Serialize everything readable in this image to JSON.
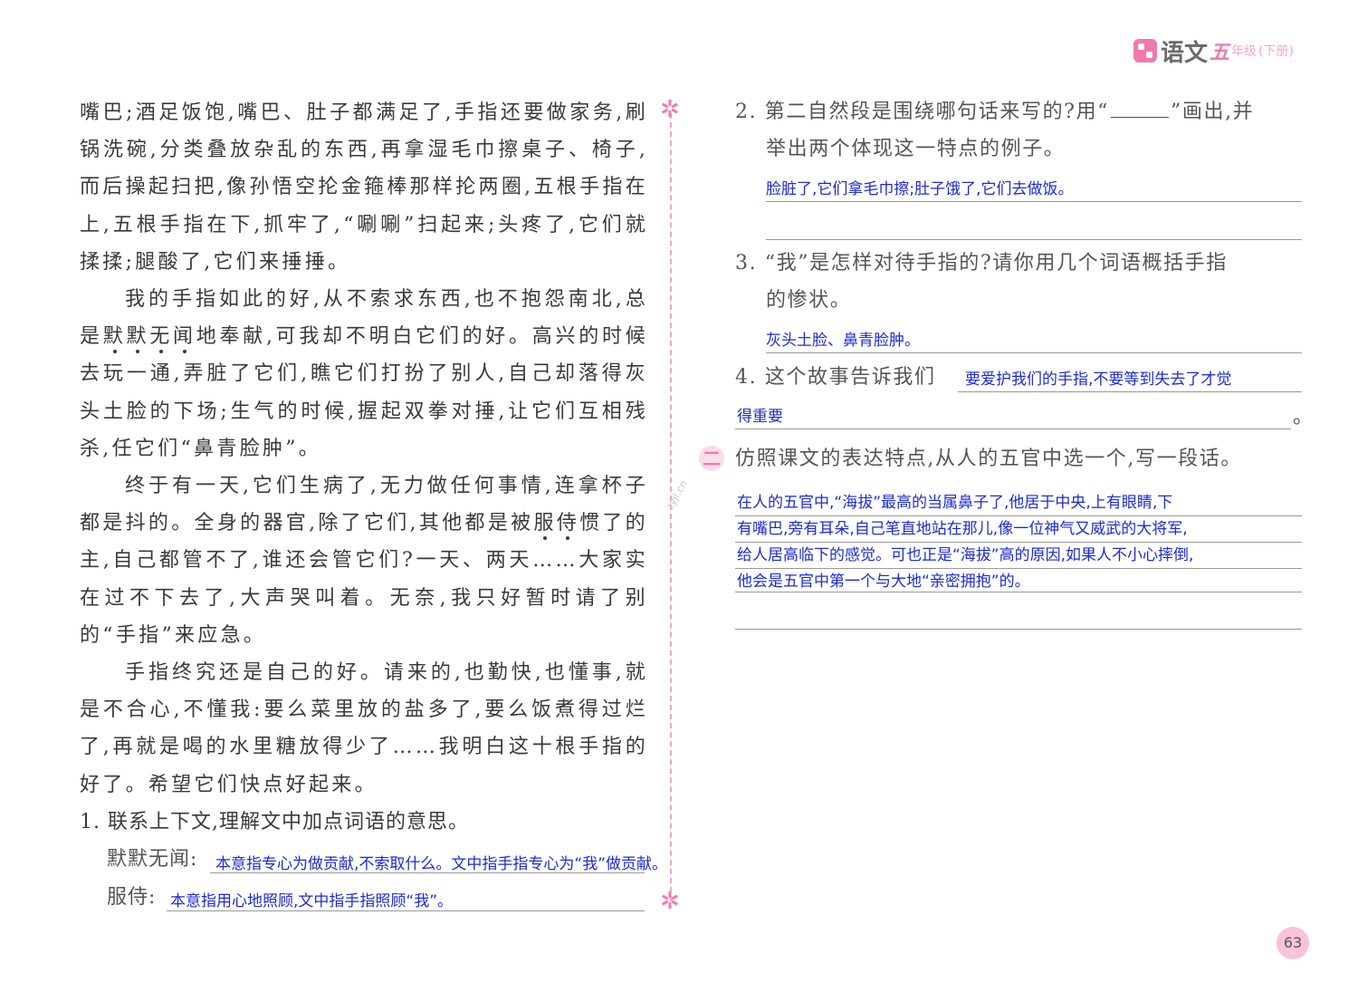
{
  "header": {
    "title": "语文",
    "grade": "五",
    "grade_suffix": "年级",
    "volume": "(下册)"
  },
  "passage": {
    "paragraphs": [
      {
        "indent": false,
        "segments": [
          {
            "t": "嘴巴;酒足饭饱,嘴巴、肚子都满足了,手指还要做家务,刷锅洗碗,分类叠放杂乱的东西,再拿湿毛巾擦桌子、椅子,而后操起扫把,像孙悟空抡金箍棒那样抡两圈,五根手指在上,五根手指在下,抓牢了,“唰唰”扫起来;头疼了,它们就揉揉;腿酸了,它们来捶捶。"
          }
        ]
      },
      {
        "indent": true,
        "segments": [
          {
            "t": "我的手指如此的好,从不索求东西,也不抱怨南北,总是"
          },
          {
            "t": "默默无闻",
            "dot": true
          },
          {
            "t": "地奉献,可我却不明白它们的好。高兴的时候去玩一通,弄脏了它们,瞧它们打扮了别人,自己却落得灰头土脸的下场;生气的时候,握起双拳对捶,让它们互相残杀,任它们“鼻青脸肿”。"
          }
        ]
      },
      {
        "indent": true,
        "segments": [
          {
            "t": "终于有一天,它们生病了,无力做任何事情,连拿杯子都是抖的。全身的器官,除了它们,其他都是被"
          },
          {
            "t": "服侍",
            "dot": true
          },
          {
            "t": "惯了的主,自己都管不了,谁还会管它们?一天、两天……大家实在过不下去了,大声哭叫着。无奈,我只好暂时请了别的“手指”来应急。"
          }
        ]
      },
      {
        "indent": true,
        "segments": [
          {
            "t": "手指终究还是自己的好。请来的,也勤快,也懂事,就是不合心,不懂我:要么菜里放的盐多了,要么饭煮得过烂了,再就是喝的水里糖放得少了……我明白这十根手指的好了。希望它们快点好起来。"
          }
        ]
      }
    ]
  },
  "questions": {
    "q1": {
      "prompt": "1. 联系上下文,理解文中加点词语的意思。",
      "items": [
        {
          "label": "默默无闻:",
          "answer": "本意指专心为做贡献,不索取什么。文中指手指专心为“我”做贡献。"
        },
        {
          "label": "服侍:",
          "answer": "本意指用心地照顾,文中指手指照顾“我”。"
        }
      ]
    },
    "q2": {
      "prompt_before": "2. 第二自然段是围绕哪句话来写的?用“",
      "prompt_after": "”画出,并",
      "prompt_line2": "举出两个体现这一特点的例子。",
      "answer": "脸脏了,它们拿毛巾擦;肚子饿了,它们去做饭。"
    },
    "q3": {
      "prompt_line1": "3. “我”是怎样对待手指的?请你用几个词语概括手指",
      "prompt_line2": "的惨状。",
      "answer": "灰头土脸、鼻青脸肿。"
    },
    "q4": {
      "prompt": "4. 这个故事告诉我们",
      "answer_line1": "要爱护我们的手指,不要等到失去了才觉",
      "answer_line2": "得重要",
      "end_mark": "。"
    }
  },
  "section2": {
    "badge": "二",
    "prompt": "仿照课文的表达特点,从人的五官中选一个,写一段话。",
    "answer_lines": [
      "在人的五官中,“海拔”最高的当属鼻子了,他居于中央,上有眼睛,下",
      "有嘴巴,旁有耳朵,自己笔直地站在那儿,像一位神气又威武的大将军,",
      "给人居高临下的感觉。可也正是“海拔”高的原因,如果人不小心摔倒,",
      "他会是五官中第一个与大地“亲密拥抱”的。"
    ]
  },
  "decor": {
    "star": "✲",
    "watermark": "zyjl.cn"
  },
  "page_number": "63",
  "colors": {
    "accent": "#f07ab0",
    "handwriting": "#1d2bd6"
  }
}
